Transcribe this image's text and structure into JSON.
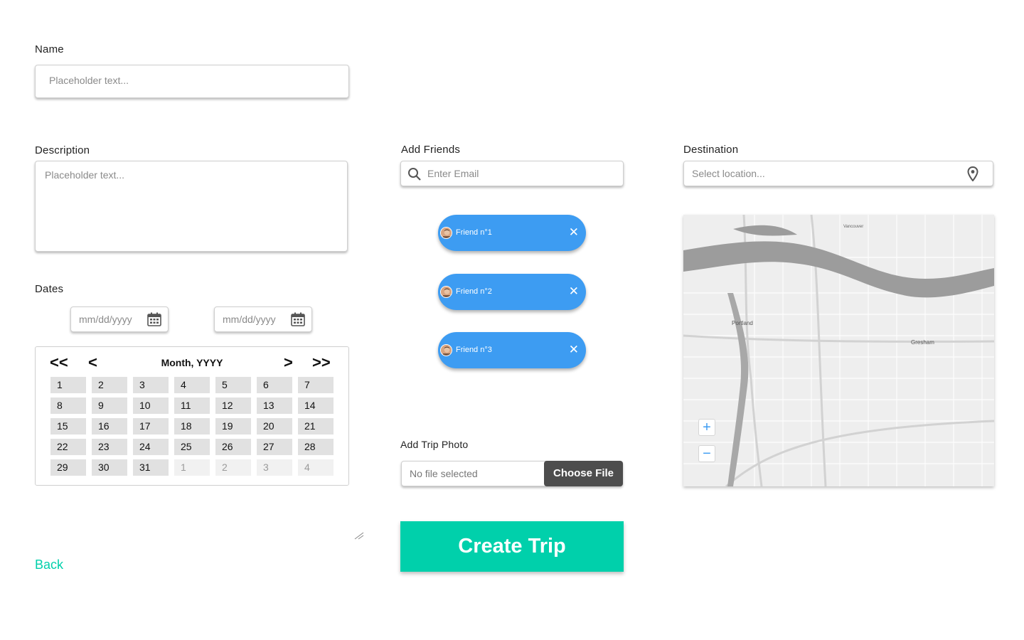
{
  "name": {
    "label": "Name",
    "placeholder": "Placeholder text..."
  },
  "description": {
    "label": "Description",
    "placeholder": "Placeholder text..."
  },
  "dates": {
    "label": "Dates",
    "start_placeholder": "mm/dd/yyyy",
    "end_placeholder": "mm/dd/yyyy"
  },
  "calendar": {
    "first_label": "<<",
    "prev_label": "<",
    "title": "Month, YYYY",
    "next_label": ">",
    "last_label": ">>",
    "days": [
      "1",
      "2",
      "3",
      "4",
      "5",
      "6",
      "7",
      "8",
      "9",
      "10",
      "11",
      "12",
      "13",
      "14",
      "15",
      "16",
      "17",
      "18",
      "19",
      "20",
      "21",
      "22",
      "23",
      "24",
      "25",
      "26",
      "27",
      "28",
      "29",
      "30",
      "31"
    ],
    "trailing_days": [
      "1",
      "2",
      "3",
      "4"
    ]
  },
  "friends": {
    "label": "Add Friends",
    "search_placeholder": "Enter Email",
    "items": [
      {
        "name": "Friend n°1"
      },
      {
        "name": "Friend n°2"
      },
      {
        "name": "Friend n°3"
      }
    ],
    "remove_icon": "close-icon"
  },
  "photo": {
    "label": "Add Trip Photo",
    "file_status": "No file selected",
    "choose_label": "Choose File"
  },
  "destination": {
    "label": "Destination",
    "placeholder": "Select location...",
    "icon": "location-pin-icon",
    "map": {
      "city_labels": [
        "Portland",
        "Gresham",
        "Vancouver"
      ],
      "zoom_in": "+",
      "zoom_out": "−"
    }
  },
  "actions": {
    "create_label": "Create Trip",
    "back_label": "Back"
  },
  "colors": {
    "accent": "#00d0ab",
    "chip": "#3d9cf2",
    "file_button": "#4d4d4d"
  }
}
